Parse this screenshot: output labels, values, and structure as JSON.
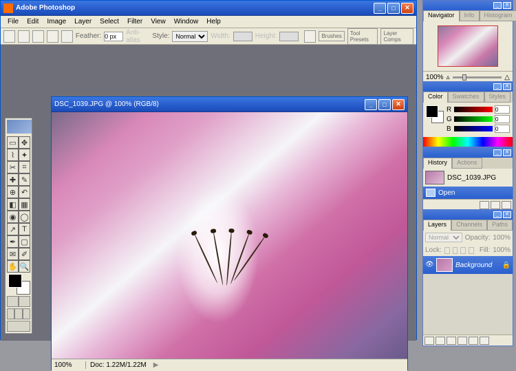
{
  "app": {
    "title": "Adobe Photoshop"
  },
  "menu": [
    "File",
    "Edit",
    "Image",
    "Layer",
    "Select",
    "Filter",
    "View",
    "Window",
    "Help"
  ],
  "options": {
    "feather_label": "Feather:",
    "feather_value": "0 px",
    "anti_alias": "Anti-alias",
    "style_label": "Style:",
    "style_value": "Normal",
    "width_label": "Width:",
    "height_label": "Height:",
    "palette_btns": [
      "Brushes",
      "Tool Presets",
      "Layer Comps"
    ]
  },
  "image_window": {
    "title": "DSC_1039.JPG @ 100% (RGB/8)",
    "zoom": "100%",
    "doc": "Doc: 1.22M/1.22M"
  },
  "navigator": {
    "tabs": [
      "Navigator",
      "Info",
      "Histogram"
    ],
    "zoom": "100%"
  },
  "color": {
    "tabs": [
      "Color",
      "Swatches",
      "Styles"
    ],
    "channels": [
      {
        "l": "R",
        "v": "0"
      },
      {
        "l": "G",
        "v": "0"
      },
      {
        "l": "B",
        "v": "0"
      }
    ]
  },
  "history": {
    "tabs": [
      "History",
      "Actions"
    ],
    "snapshot": "DSC_1039.JPG",
    "step": "Open"
  },
  "layers": {
    "tabs": [
      "Layers",
      "Channels",
      "Paths"
    ],
    "mode": "Normal",
    "opacity_label": "Opacity:",
    "opacity": "100%",
    "lock_label": "Lock:",
    "fill_label": "Fill:",
    "fill": "100%",
    "layer_name": "Background"
  }
}
